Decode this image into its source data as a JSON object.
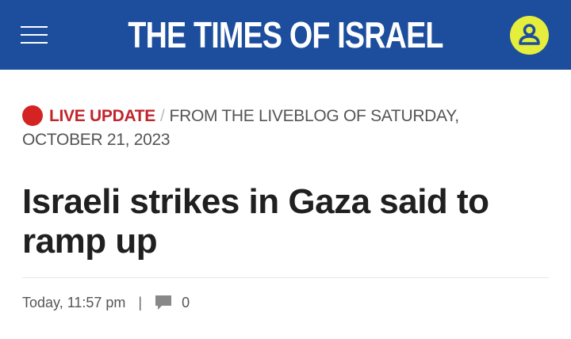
{
  "header": {
    "brand": "THE TIMES OF ISRAEL",
    "menu_icon": "hamburger-menu-icon",
    "account_icon": "user-account-icon",
    "colors": {
      "background": "#1c4e9d",
      "account_button": "#e5ee3c"
    }
  },
  "article": {
    "live_label": "LIVE UPDATE",
    "separator": "/",
    "source_line": "FROM THE LIVEBLOG OF SATURDAY, OCTOBER 21, 2023",
    "headline": "Israeli strikes in Gaza said to ramp up",
    "timestamp": "Today, 11:57 pm",
    "meta_separator": "|",
    "comment_count": "0",
    "comment_icon": "comment-bubble-icon",
    "colors": {
      "live": "#d52323"
    }
  }
}
